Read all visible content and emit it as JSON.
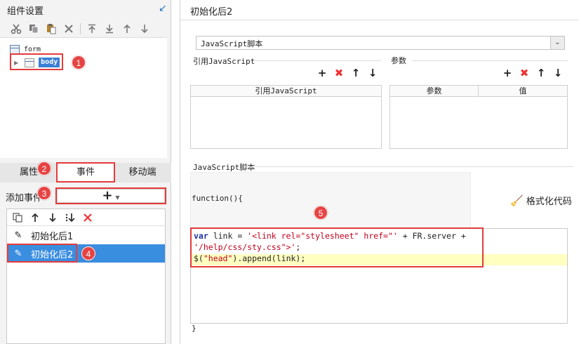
{
  "left": {
    "title": "组件设置",
    "tree": {
      "root": "form",
      "child": "body"
    },
    "tabs": [
      "属性",
      "事件",
      "移动端"
    ],
    "add_event_label": "添加事件",
    "add_symbol": "+",
    "events": [
      "初始化后1",
      "初始化后2"
    ]
  },
  "right": {
    "title": "初始化后2",
    "combo_value": "JavaScript脚本",
    "ref_js_label": "引用JavaScript",
    "params_label": "参数",
    "ref_js_column": "引用JavaScript",
    "param_column": "参数",
    "value_column": "值",
    "script_label": "JavaScript脚本",
    "function_header": "function(){",
    "format_button": "格式化代码",
    "code": {
      "line1_kw": "var",
      "line1_a": " link = ",
      "line1_str": "'<link rel=\"stylesheet\" href=\"'",
      "line1_b": " + FR.server +",
      "line2_str": "'/help/css/sty.css\">'",
      "line2_b": ";",
      "line3_a": "$(",
      "line3_str": "\"head\"",
      "line3_b": ").append(link);"
    },
    "closing": "}"
  },
  "badges": [
    "1",
    "2",
    "3",
    "4",
    "5"
  ],
  "colors": {
    "accent": "#3a8ee0",
    "highlight": "#e43b3b"
  }
}
